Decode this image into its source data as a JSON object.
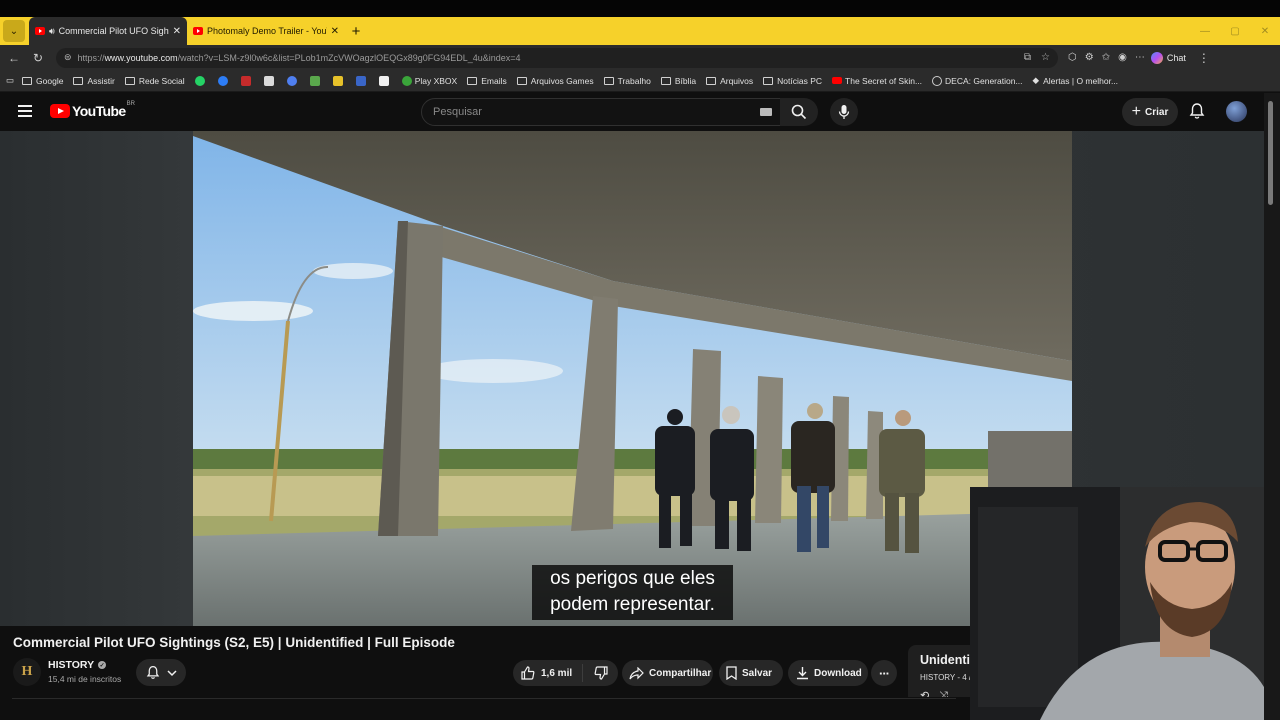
{
  "browser": {
    "tabs": [
      {
        "title": "Commercial Pilot UFO Sighting",
        "active": true,
        "audio": true
      },
      {
        "title": "Photomaly Demo Trailer - YouTube",
        "active": false,
        "audio": false
      }
    ],
    "url": {
      "prefix": "https://",
      "domain": "www.youtube.com",
      "path": "/watch?v=LSM-z9l0w6c&list=PLob1mZcVWOagzlOEQGx89g0FG94EDL_4u&index=4"
    },
    "chat_label": "Chat",
    "bookmarks": [
      {
        "label": "Google",
        "icon": "folder-icon"
      },
      {
        "label": "Assistir",
        "icon": "folder-icon"
      },
      {
        "label": "Rede Social",
        "icon": "folder-icon"
      },
      {
        "label": "Play XBOX",
        "icon": "xbox-icon"
      },
      {
        "label": "Emails",
        "icon": "folder-icon"
      },
      {
        "label": "Arquivos Games",
        "icon": "folder-icon"
      },
      {
        "label": "Trabalho",
        "icon": "folder-icon"
      },
      {
        "label": "Bíblia",
        "icon": "folder-icon"
      },
      {
        "label": "Arquivos",
        "icon": "folder-icon"
      },
      {
        "label": "Notícias PC",
        "icon": "folder-icon"
      },
      {
        "label": "The Secret of Skin...",
        "icon": "youtube-icon"
      },
      {
        "label": "DECA: Generation...",
        "icon": "globe-icon"
      },
      {
        "label": "Alertas | O melhor...",
        "icon": "diamond-icon"
      }
    ]
  },
  "youtube": {
    "logo_text": "YouTube",
    "region": "BR",
    "search_placeholder": "Pesquisar",
    "create_label": "Criar"
  },
  "video": {
    "subtitle_line1": "os perigos que eles",
    "subtitle_line2": "podem representar.",
    "title": "Commercial Pilot UFO Sightings (S2, E5) | Unidentified | Full Episode",
    "channel": "HISTORY",
    "subscribers": "15,4 mi de inscritos",
    "likes": "1,6 mil",
    "share_label": "Compartilhar",
    "save_label": "Salvar",
    "download_label": "Download",
    "more_label": "···"
  },
  "playlist": {
    "title": "Unidenti",
    "meta": "HISTORY - 4 /"
  },
  "colors": {
    "tabbar": "#f6d12a",
    "youtube_red": "#ff0000",
    "background": "#0f0f0f"
  }
}
